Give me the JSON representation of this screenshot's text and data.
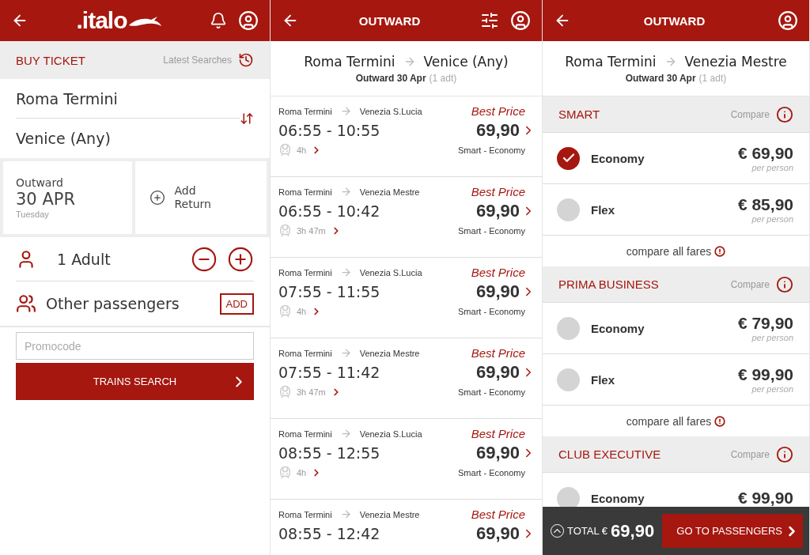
{
  "search_screen": {
    "logo": ".italo",
    "section_title": "BUY TICKET",
    "latest_searches": "Latest Searches",
    "origin": "Roma Termini",
    "destination": "Venice (Any)",
    "outward": {
      "label": "Outward",
      "date": "30 APR",
      "weekday": "Tuesday"
    },
    "add_return": "Add Return",
    "adults": "1 Adult",
    "other_passengers": "Other passengers",
    "add_button": "ADD",
    "promocode": {
      "placeholder": "Promocode"
    },
    "search_button": "TRAINS SEARCH"
  },
  "results_screen": {
    "title": "OUTWARD",
    "origin": "Roma Termini",
    "destination": "Venice (Any)",
    "date": "Outward 30 Apr",
    "passengers": "(1 adt)",
    "trains": [
      {
        "from": "Roma Termini",
        "to": "Venezia S.Lucia",
        "badge": "Best Price",
        "times": "06:55 - 10:55",
        "price": "69,90",
        "duration": "4h",
        "fare_class": "Smart - Economy"
      },
      {
        "from": "Roma Termini",
        "to": "Venezia Mestre",
        "badge": "Best Price",
        "times": "06:55 - 10:42",
        "price": "69,90",
        "duration": "3h 47m",
        "fare_class": "Smart - Economy"
      },
      {
        "from": "Roma Termini",
        "to": "Venezia S.Lucia",
        "badge": "Best Price",
        "times": "07:55 - 11:55",
        "price": "69,90",
        "duration": "4h",
        "fare_class": "Smart - Economy"
      },
      {
        "from": "Roma Termini",
        "to": "Venezia Mestre",
        "badge": "Best Price",
        "times": "07:55 - 11:42",
        "price": "69,90",
        "duration": "3h 47m",
        "fare_class": "Smart - Economy"
      },
      {
        "from": "Roma Termini",
        "to": "Venezia S.Lucia",
        "badge": "Best Price",
        "times": "08:55 - 12:55",
        "price": "69,90",
        "duration": "4h",
        "fare_class": "Smart - Economy"
      },
      {
        "from": "Roma Termini",
        "to": "Venezia Mestre",
        "badge": "Best Price",
        "times": "08:55 - 12:42",
        "price": "69,90"
      }
    ]
  },
  "fares_screen": {
    "title": "OUTWARD",
    "origin": "Roma Termini",
    "destination": "Venezia Mestre",
    "date": "Outward 30 Apr",
    "passengers": "(1 adt)",
    "sections": [
      {
        "name": "SMART",
        "compare": "Compare",
        "fares": [
          {
            "name": "Economy",
            "price": "€ 69,90",
            "per_person": "per person",
            "selected": true
          },
          {
            "name": "Flex",
            "price": "€ 85,90",
            "per_person": "per person",
            "selected": false
          }
        ],
        "compare_all": "compare all fares"
      },
      {
        "name": "PRIMA BUSINESS",
        "compare": "Compare",
        "fares": [
          {
            "name": "Economy",
            "price": "€ 79,90",
            "per_person": "per person",
            "selected": false
          },
          {
            "name": "Flex",
            "price": "€ 99,90",
            "per_person": "per person",
            "selected": false
          }
        ],
        "compare_all": "compare all fares"
      },
      {
        "name": "CLUB EXECUTIVE",
        "compare": "Compare",
        "fares": [
          {
            "name": "Economy",
            "price": "€ 99,90",
            "selected": false
          }
        ]
      }
    ],
    "total_label": "TOTAL €",
    "total": "69,90",
    "next_button": "GO TO PASSENGERS"
  }
}
